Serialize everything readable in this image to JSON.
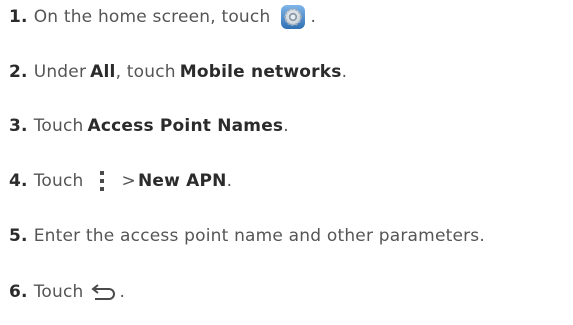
{
  "steps": [
    {
      "number": "1.",
      "text_before": "On the home screen, touch",
      "icon": "settings-icon",
      "text_after": "."
    },
    {
      "number": "2.",
      "text_1": "Under",
      "bold_1": "All",
      "text_2": ", touch",
      "bold_2": "Mobile networks",
      "text_3": "."
    },
    {
      "number": "3.",
      "text_1": "Touch",
      "bold_1": "Access Point Names",
      "text_2": "."
    },
    {
      "number": "4.",
      "text_1": "Touch",
      "icon": "overflow-menu-icon",
      "text_2": ">",
      "bold_1": "New APN",
      "text_3": "."
    },
    {
      "number": "5.",
      "text_1": "Enter the access point name and other parameters."
    },
    {
      "number": "6.",
      "text_1": "Touch",
      "icon": "back-icon",
      "text_2": "."
    }
  ],
  "colors": {
    "text": "#555555",
    "bold_text": "#2b2b2b",
    "settings_icon_blue": "#4a8ed0"
  }
}
